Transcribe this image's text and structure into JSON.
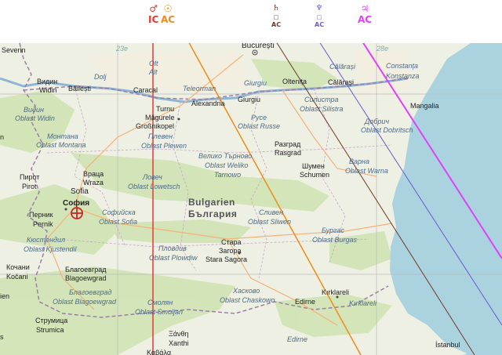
{
  "planets": [
    {
      "name": "mars-icon",
      "glyph": "♂",
      "angle": "IC",
      "color": "#e53935"
    },
    {
      "name": "sun-icon",
      "glyph": "☉",
      "angle": "AC",
      "color": "#ef8c1a"
    },
    {
      "name": "saturn-icon",
      "glyph": "♄",
      "angle": "AC",
      "color": "#6d3a2a",
      "sub": "□"
    },
    {
      "name": "neptune-icon",
      "glyph": "♆",
      "angle": "AC",
      "color": "#6a5acd",
      "sub": "□"
    },
    {
      "name": "jupiter-icon",
      "glyph": "♃",
      "angle": "AC",
      "color": "#e040fb"
    }
  ],
  "colors": {
    "sea": "#aad3df",
    "land": "#eef0e4",
    "forest": "#cfe3b4",
    "border": "#9c7fa6"
  },
  "labels": {
    "severin": "Severin",
    "bucuresti": "București",
    "vidin_bg": "Видин",
    "vidin": "Widin",
    "bailesti": "Băilești",
    "dolj": "Dolj",
    "olt": "Olt",
    "alt": "Alt",
    "caracal": "Caracal",
    "teleorman": "Teleorman",
    "giurgiu_region": "Giurgiu",
    "oltenita": "Oltenița",
    "calarasi": "Călărași",
    "calarasi_town": "Călărași",
    "constanta": "Constanța",
    "konstanza": "Konstanza",
    "oblast_vidin_bg": "Видин",
    "oblast_vidin": "Oblast Widin",
    "turnu": "Turnu",
    "magurele": "Măgurele",
    "grossnikopel": "Großnikopel",
    "alexandria": "Alexandria",
    "giurgiu": "Giurgiu",
    "silistra_bg": "Силистра",
    "silistra": "Oblast Silistra",
    "ruse_bg": "Русе",
    "ruse": "Oblast Russe",
    "mangalia": "Mangalia",
    "dobrich_bg": "Добрич",
    "dobrich": "Oblast Dobritsch",
    "montana_bg": "Монтана",
    "montana": "Oblast Montana",
    "pleven_bg": "Плевен",
    "pleven": "Oblast Plewen",
    "vt_bg": "Велико Търново",
    "vt": "Oblast Weliko",
    "tarnowo": "Tarnowo",
    "razgrad_bg": "Разград",
    "razgrad": "Rasgrad",
    "shumen_bg": "Шумен",
    "shumen": "Schumen",
    "varna_bg": "Варна",
    "varna": "Oblast Warna",
    "pirot_sr": "Пирот",
    "pirot": "Pirot",
    "vratsa_bg": "Враца",
    "vratsa": "Wraza",
    "lovech_bg": "Ловеч",
    "lovech": "Oblast Lowetsch",
    "sofia": "Sofia",
    "sofia_bg": "София",
    "pernik_bg": "Перник",
    "pernik": "Pernik",
    "sofiyska_bg": "Софийска",
    "oblast_sofia": "Oblast Sofia",
    "bulgarien": "Bulgarien",
    "balgaria": "България",
    "sliven_bg": "Сливен",
    "sliven": "Oblast Sliwen",
    "burgas_bg": "Бургас",
    "burgas": "Oblast Burgas",
    "kyustendil_bg": "Кюстендил",
    "kyustendil": "Oblast Kjustendil",
    "plovdiv_bg": "Пловдив",
    "plovdiv": "Oblast Plowdiw",
    "stara_bg": "Стара",
    "zagora_bg": "Загора",
    "stara_zagora": "Stara Sagora",
    "kochani": "Кочани",
    "kocani": "Kočani",
    "blagoevgrad_bg": "Благоевград",
    "blagoevgrad": "Blagoewgrad",
    "blag_region_bg": "Благоевград",
    "blag_region": "Oblast Blagoewgrad",
    "haskovo_bg": "Хасково",
    "haskovo": "Oblast Chaskowo",
    "smolyan_bg": "Смолян",
    "smolyan": "Oblast Smoljan",
    "edirne": "Edirne",
    "edirne2": "Edirne",
    "kirklareli": "Kırklareli",
    "kirklareli_region": "Kırklareli",
    "strumica_bg": "Струмица",
    "strumica": "Strumica",
    "xanthi_gr": "Ξάνθη",
    "xanthi": "Xanthi",
    "kavala": "Καβάλα",
    "istanbul": "İstanbul",
    "ien": "ien",
    "n": "n",
    "s": "s",
    "lon_23": "23e",
    "lon_28": "28e"
  }
}
